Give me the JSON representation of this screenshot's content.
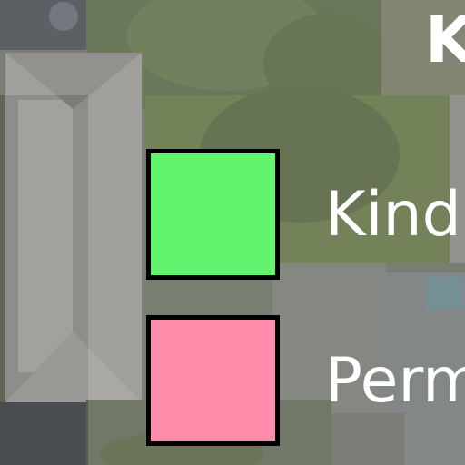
{
  "map": {
    "basemap": "aerial-imagery"
  },
  "legend": {
    "title": "K",
    "items": [
      {
        "label": "Kind",
        "color": "#62f46f"
      },
      {
        "label": "Perm",
        "color": "#fd8dab"
      }
    ]
  }
}
